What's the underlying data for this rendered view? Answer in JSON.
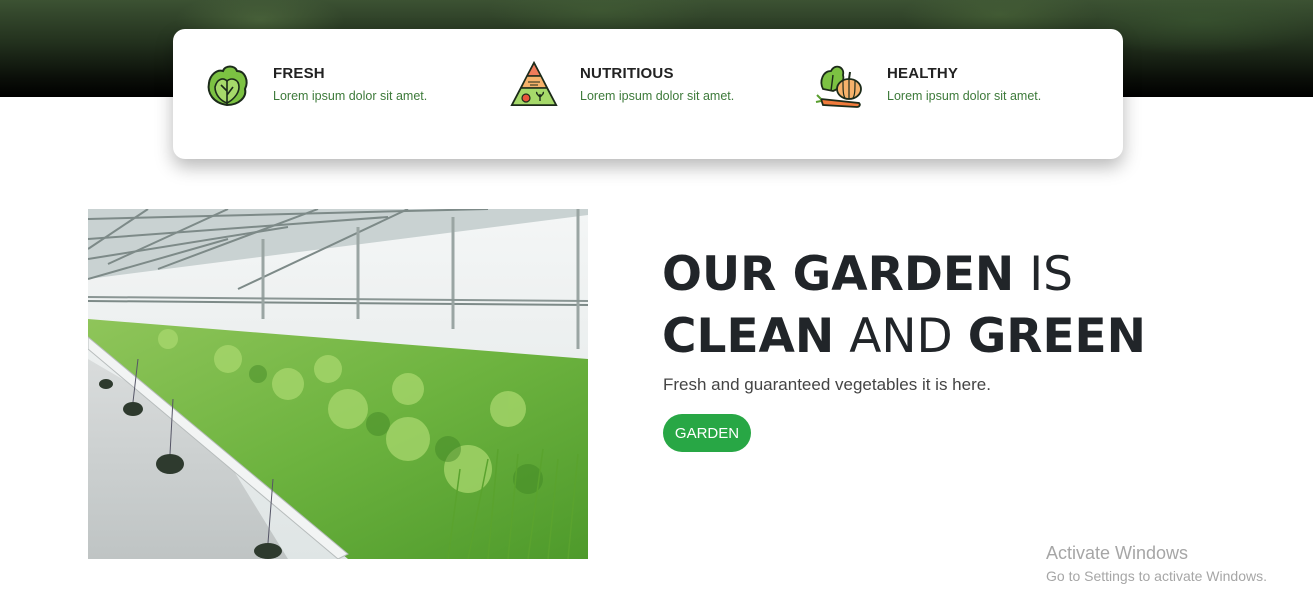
{
  "features": [
    {
      "title": "FRESH",
      "text": "Lorem ipsum dolor sit amet.",
      "icon": "lettuce-icon"
    },
    {
      "title": "NUTRITIOUS",
      "text": "Lorem ipsum dolor sit amet.",
      "icon": "food-pyramid-icon"
    },
    {
      "title": "HEALTHY",
      "text": "Lorem ipsum dolor sit amet.",
      "icon": "vegetables-icon"
    }
  ],
  "headline": {
    "line1_bold": "OUR GARDEN",
    "line1_light": "IS",
    "line2_bold_a": "CLEAN",
    "line2_light": "AND",
    "line2_bold_b": "GREEN"
  },
  "subtext": "Fresh and guaranteed vegetables it is here.",
  "cta": {
    "label": "GARDEN",
    "color": "#28a745"
  },
  "watermark": {
    "title": "Activate Windows",
    "subtitle": "Go to Settings to activate Windows."
  }
}
